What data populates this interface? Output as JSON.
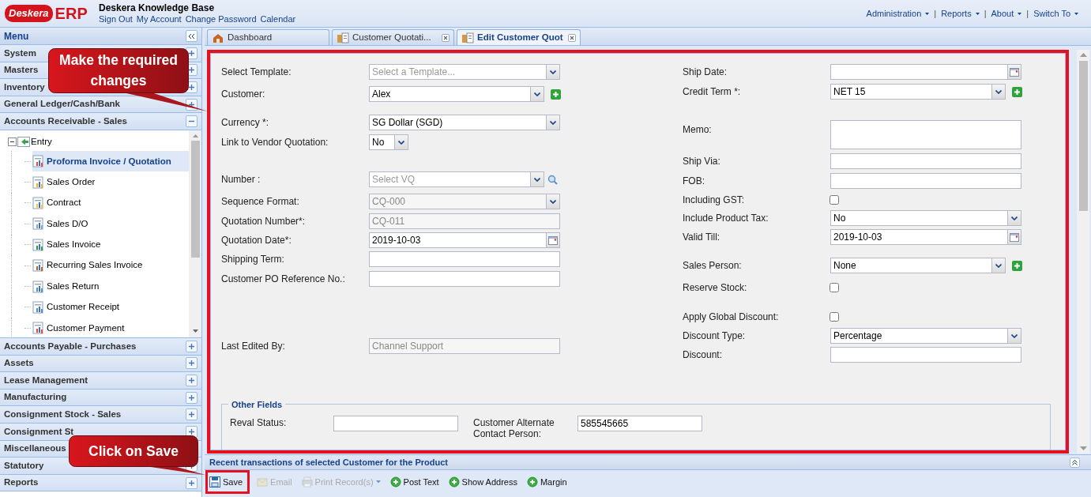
{
  "logo": {
    "name": "Deskera",
    "product": "ERP"
  },
  "header": {
    "title": "Deskera Knowledge Base",
    "links": [
      "Sign Out",
      "My Account",
      "Change Password",
      "Calendar"
    ]
  },
  "top_menu": [
    {
      "label": "Administration"
    },
    {
      "separator": "|",
      "label": "Reports"
    },
    {
      "separator": "|",
      "label": "About"
    },
    {
      "separator": "|",
      "label": "Switch To"
    }
  ],
  "sidebar": {
    "title": "Menu",
    "sections": [
      {
        "label": "System",
        "expanded": false
      },
      {
        "label": "Masters",
        "expanded": false
      },
      {
        "label": "Inventory",
        "expanded": false
      },
      {
        "label": "General Ledger/Cash/Bank",
        "expanded": false
      },
      {
        "label": "Accounts Receivable - Sales",
        "expanded": true,
        "children": [
          {
            "label": "Entry",
            "expanded": true,
            "children": [
              {
                "label": "Proforma Invoice / Quotation",
                "selected": true
              },
              {
                "label": "Sales Order",
                "selected": false
              },
              {
                "label": "Contract",
                "selected": false
              },
              {
                "label": "Sales D/O",
                "selected": false
              },
              {
                "label": "Sales Invoice",
                "selected": false
              },
              {
                "label": "Recurring Sales Invoice",
                "selected": false
              },
              {
                "label": "Sales Return",
                "selected": false
              },
              {
                "label": "Customer Receipt",
                "selected": false
              },
              {
                "label": "Customer Payment",
                "selected": false
              }
            ]
          }
        ]
      },
      {
        "label": "Accounts Payable - Purchases",
        "expanded": false
      },
      {
        "label": "Assets",
        "expanded": false
      },
      {
        "label": "Lease Management",
        "expanded": false
      },
      {
        "label": "Manufacturing",
        "expanded": false
      },
      {
        "label": "Consignment Stock - Sales",
        "expanded": false
      },
      {
        "label": "Consignment St",
        "expanded": false
      },
      {
        "label": "Miscellaneous"
      },
      {
        "label": "Statutory",
        "expanded": false
      },
      {
        "label": "Reports",
        "expanded": false
      }
    ]
  },
  "tabs": [
    {
      "label": "Dashboard",
      "selected": false,
      "closable": false
    },
    {
      "label": "Customer Quotati...",
      "selected": false,
      "closable": true
    },
    {
      "label": "Edit Customer Quot",
      "selected": true,
      "closable": true
    }
  ],
  "form": {
    "left": [
      {
        "label": "Select Template:",
        "kind": "combo",
        "placeholder": "Select a Template..."
      },
      {
        "label": "Customer:",
        "kind": "combo",
        "value": "Alex",
        "add_button": true
      },
      {
        "label": "Currency *:",
        "kind": "combo",
        "value": "SG Dollar (SGD)"
      },
      {
        "label": "Link to Vendor Quotation:",
        "kind": "small_combo",
        "value": "No"
      },
      {
        "label": "Number :",
        "kind": "lookup",
        "placeholder": "Select VQ"
      },
      {
        "label": "Sequence Format:",
        "kind": "combo",
        "value": "CQ-000",
        "disabled": true
      },
      {
        "label": "Quotation Number*:",
        "kind": "text",
        "value": "CQ-011",
        "disabled": true
      },
      {
        "label": "Quotation Date*:",
        "kind": "date",
        "value": "2019-10-03"
      },
      {
        "label": "Shipping Term:",
        "kind": "text"
      },
      {
        "label": "Customer PO Reference No.:",
        "kind": "text"
      },
      {
        "label": "Last Edited By:",
        "kind": "text",
        "value": "Channel Support",
        "disabled": true
      }
    ],
    "right": [
      {
        "label": "Ship Date:",
        "kind": "date"
      },
      {
        "label": "Credit Term *:",
        "kind": "combo",
        "value": "NET 15",
        "add_button": true
      },
      {
        "label": "Memo:",
        "kind": "textarea"
      },
      {
        "label": "Ship Via:",
        "kind": "text"
      },
      {
        "label": "FOB:",
        "kind": "text"
      },
      {
        "label": "Including GST:",
        "kind": "checkbox",
        "checked": false
      },
      {
        "label": "Include Product Tax:",
        "kind": "combo",
        "value": "No"
      },
      {
        "label": "Valid Till:",
        "kind": "date",
        "value": "2019-10-03"
      },
      {
        "label": "Sales Person:",
        "kind": "combo",
        "value": "None",
        "add_button": true
      },
      {
        "label": "Reserve Stock:",
        "kind": "checkbox",
        "checked": false
      },
      {
        "label": "Apply Global Discount:",
        "kind": "checkbox",
        "checked": false
      },
      {
        "label": "Discount Type:",
        "kind": "combo",
        "value": "Percentage"
      },
      {
        "label": "Discount:",
        "kind": "text"
      }
    ],
    "other_fields": {
      "title": "Other Fields",
      "fields": [
        {
          "label": "Reval Status:"
        },
        {
          "label": "Customer Alternate Contact Person:",
          "value": "585545665"
        }
      ]
    }
  },
  "recent_bar": "Recent transactions of selected Customer for the Product",
  "toolbar": [
    {
      "label": "Save",
      "kind": "save",
      "disabled": false
    },
    {
      "label": "Email",
      "kind": "email",
      "disabled": true
    },
    {
      "label": "Print Record(s)",
      "kind": "print",
      "disabled": true,
      "has_menu": true
    },
    {
      "label": "Post Text",
      "kind": "add",
      "disabled": false
    },
    {
      "label": "Show Address",
      "kind": "add",
      "disabled": false
    },
    {
      "label": "Margin",
      "kind": "add",
      "disabled": false
    }
  ],
  "callouts": [
    {
      "text": "Make the required changes"
    },
    {
      "text": "Click on Save"
    }
  ]
}
